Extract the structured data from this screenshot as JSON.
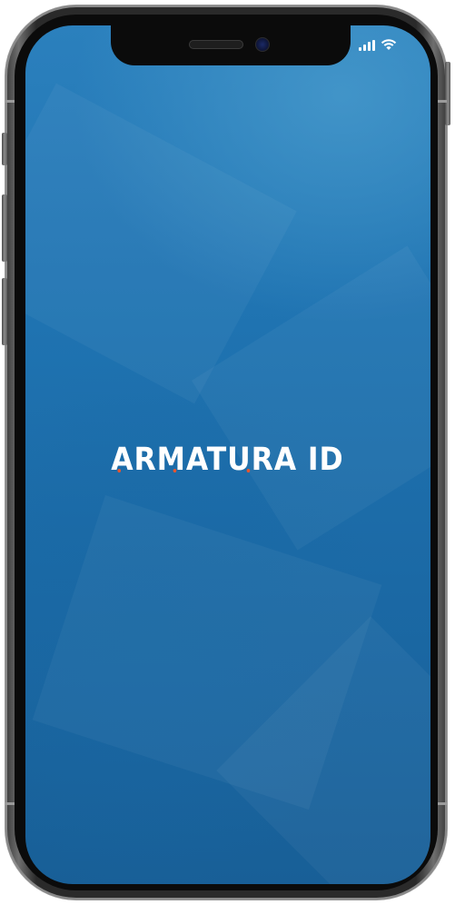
{
  "app": {
    "brand_name": "ARMATURA ID",
    "accent_color": "#e8552e"
  },
  "status_bar": {
    "signal_icon": "cellular-signal-icon",
    "wifi_icon": "wifi-icon"
  },
  "colors": {
    "screen_background": "#1f73b1",
    "device_frame": "#2a2a2a"
  }
}
